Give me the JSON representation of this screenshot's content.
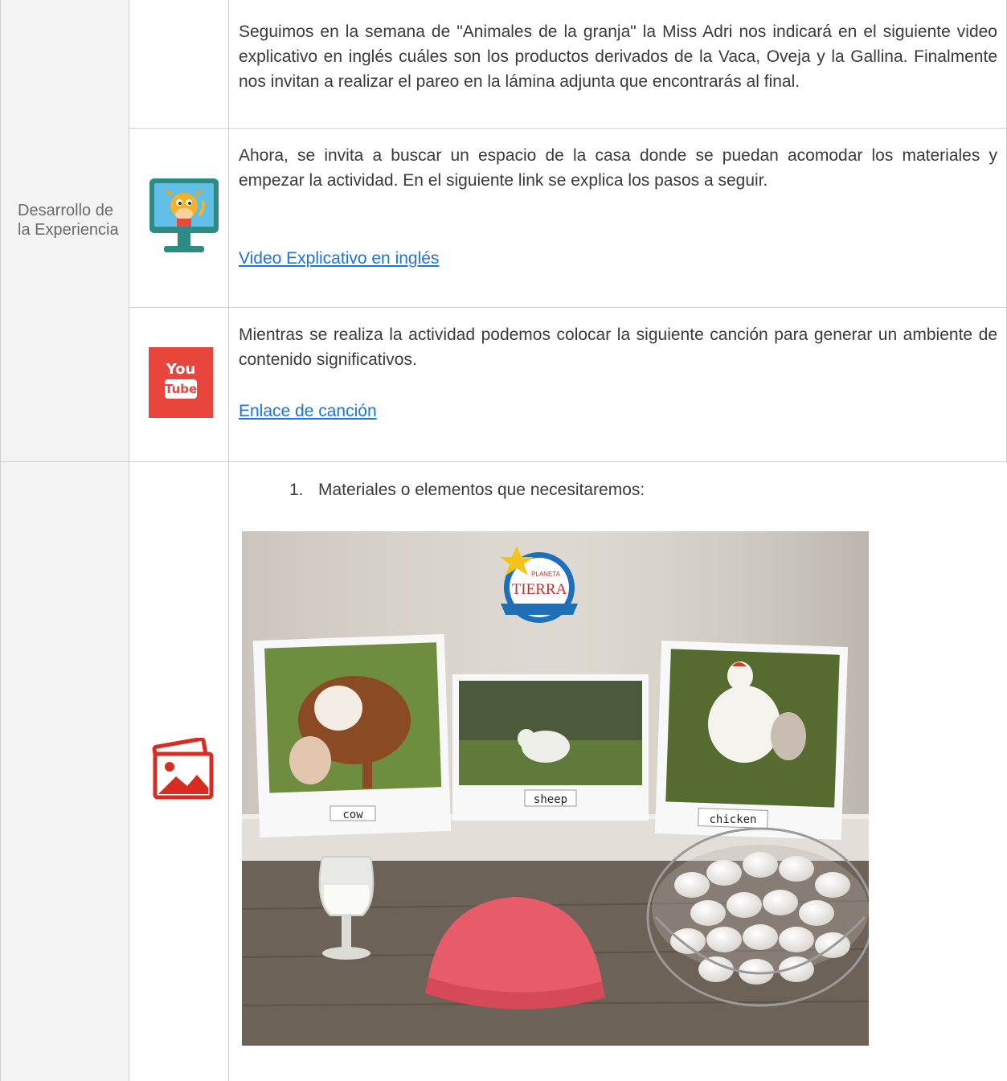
{
  "section_label": "Desarrollo de la Experiencia",
  "rows": [
    {
      "text": "Seguimos en la semana de \"Animales de la granja\" la Miss Adri nos indicará en el siguiente video explicativo en inglés cuáles son los productos derivados de la Vaca, Oveja y la Gallina. Finalmente nos invitan a realizar el pareo en la lámina adjunta que encontrarás al final."
    },
    {
      "icon": "monitor-cow-icon",
      "text": "Ahora, se invita a buscar un espacio de la casa donde se puedan acomodar los materiales y empezar la actividad. En el siguiente link se explica los pasos a seguir.",
      "link": "Video Explicativo en inglés"
    },
    {
      "icon": "youtube-icon",
      "icon_text_top": "You",
      "icon_text_bottom": "Tube",
      "text": "Mientras se realiza la actividad podemos colocar la siguiente canción para generar un ambiente de contenido significativos.",
      "link": "Enlace de canción"
    },
    {
      "icon": "image-gallery-icon",
      "list_number": "1.",
      "list_text": "Materiales o elementos que necesitaremos:",
      "photo": {
        "logo_top": "PLANETA",
        "logo_bottom": "TIERRA",
        "cards": [
          "cow",
          "sheep",
          "chicken"
        ]
      }
    }
  ],
  "colors": {
    "link": "#1a73e8",
    "youtube_red": "#e8453c",
    "monitor_teal": "#2e8b84",
    "gallery_red": "#d82b22"
  }
}
